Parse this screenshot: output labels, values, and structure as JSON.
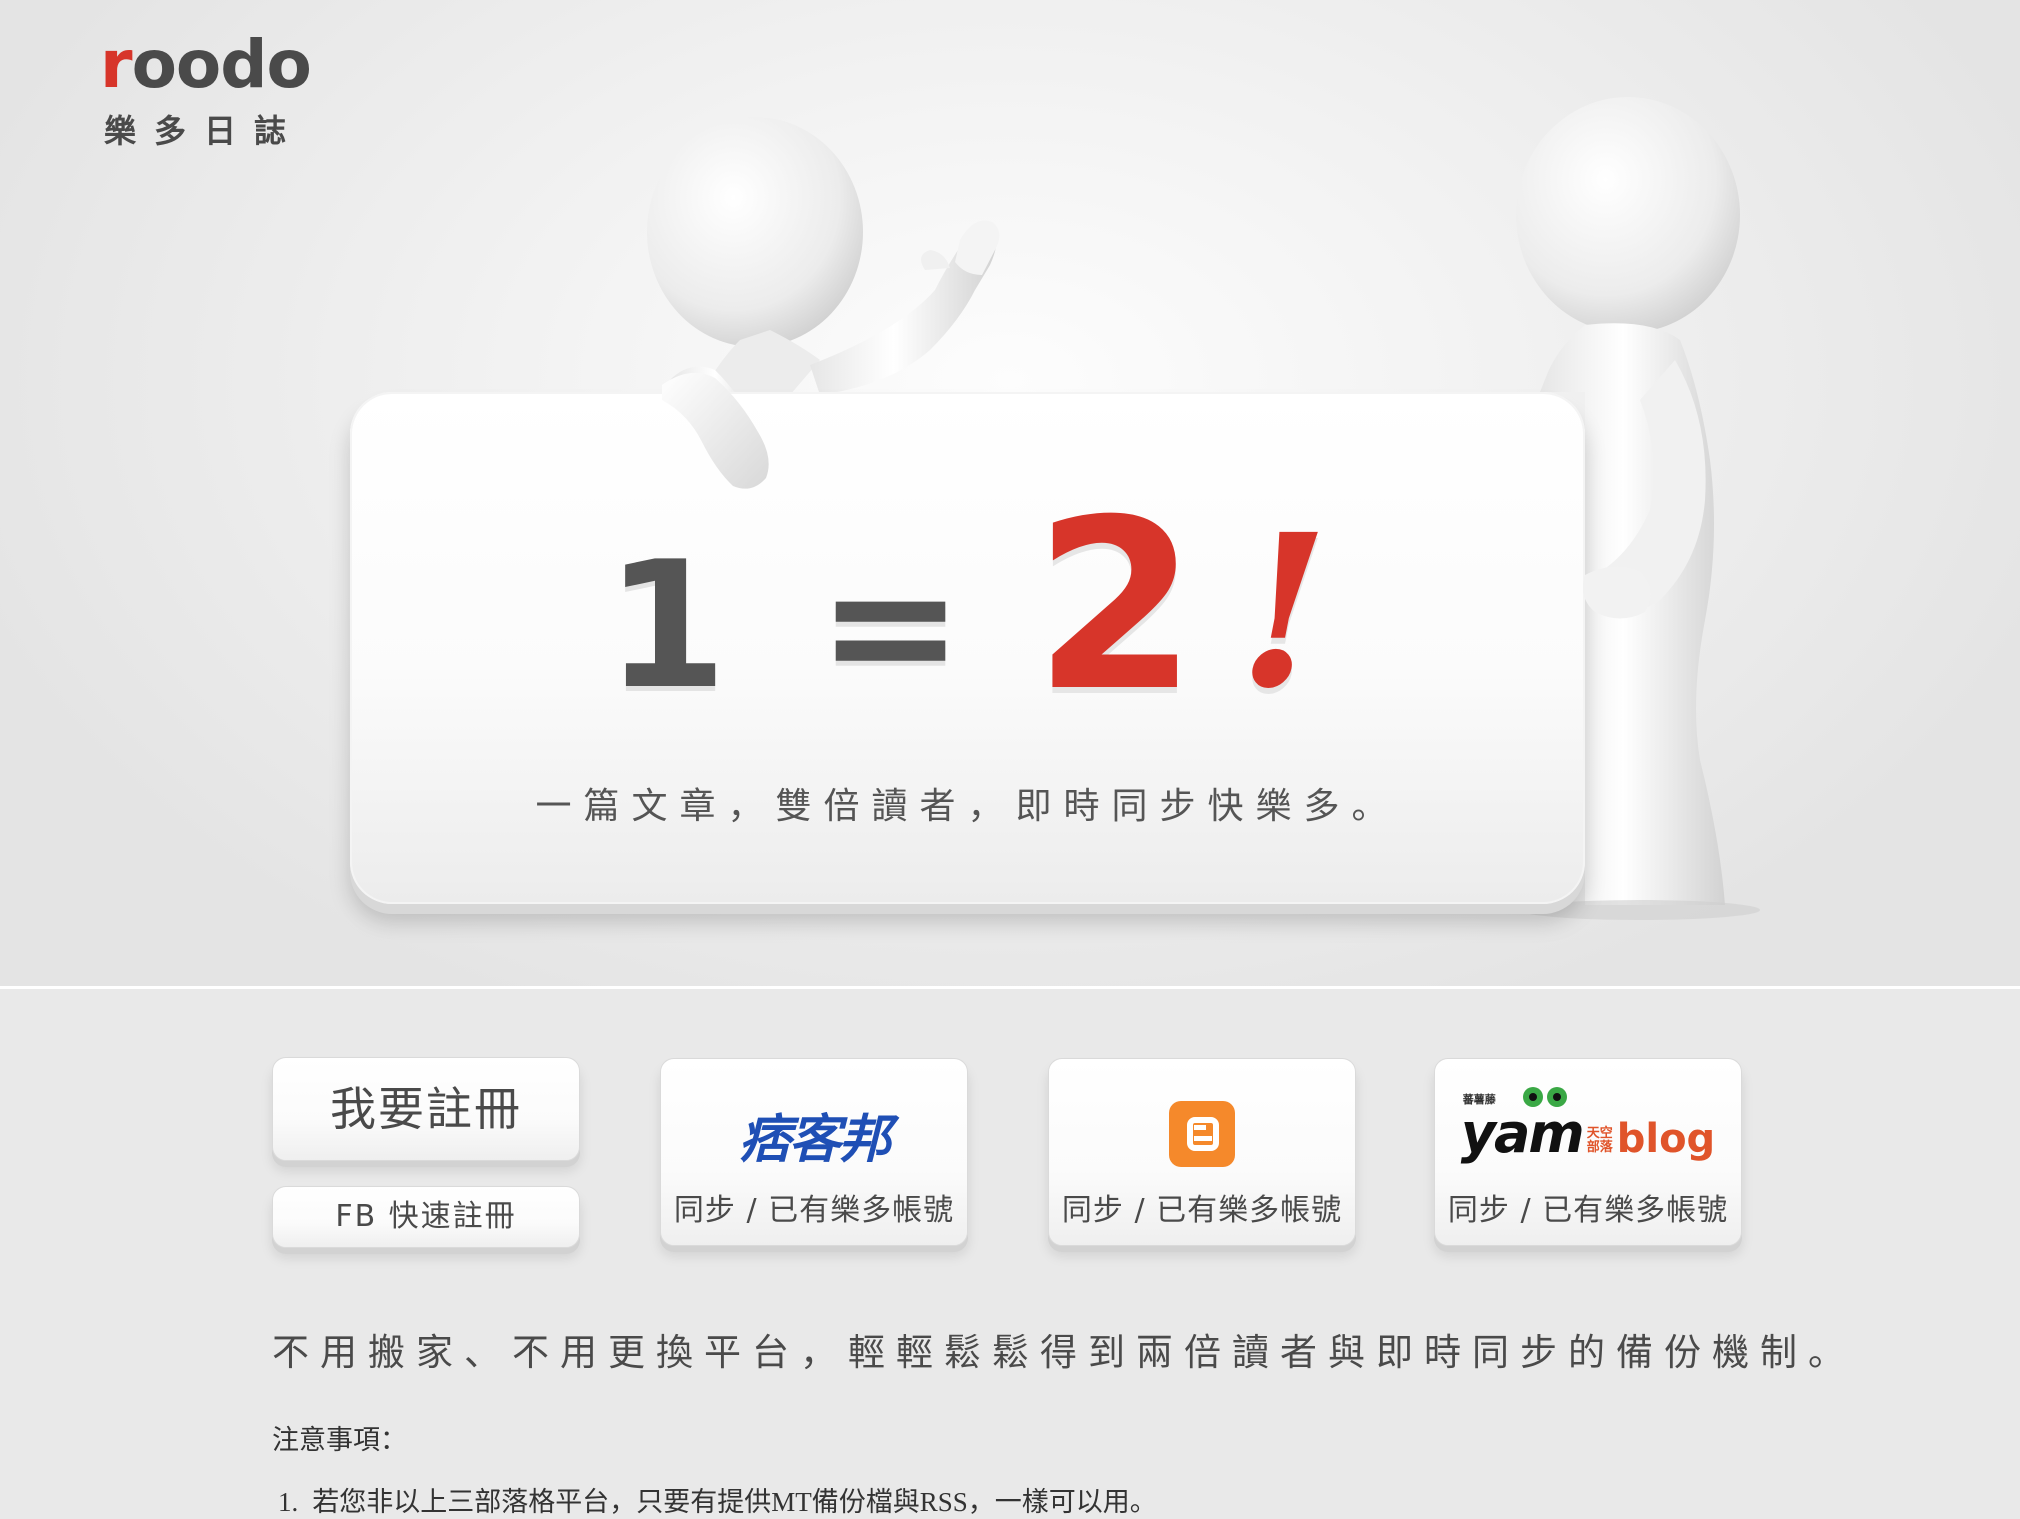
{
  "logo": {
    "word_r": "r",
    "word_rest": "oodo",
    "chinese": "樂多日誌"
  },
  "hero": {
    "eq_one": "1",
    "eq_equals": "=",
    "eq_two": "2",
    "eq_bang": "!",
    "slogan": "一篇文章，雙倍讀者，即時同步快樂多。"
  },
  "buttons": {
    "register": "我要註冊",
    "fb_register": "FB 快速註冊",
    "sync_label": "同步 / 已有樂多帳號",
    "pixnet_logo_text": "痞客邦",
    "yam_word": "yam",
    "yam_small": "天空\n部落",
    "yam_blog": "blog",
    "yam_tiny": "蕃薯藤"
  },
  "tagline": "不用搬家、不用更換平台，輕輕鬆鬆得到兩倍讀者與即時同步的備份機制。",
  "notes": {
    "title": "注意事項：",
    "items": [
      {
        "num": "1.",
        "text": "若您非以上三部落格平台，只要有提供MT備份檔與RSS，一樣可以用。"
      }
    ]
  },
  "colors": {
    "accent_red": "#d7352a",
    "pixnet_blue": "#1f4fb5",
    "blogger_orange": "#f5892b",
    "yam_orange": "#e0542a",
    "yam_green": "#3aa845"
  }
}
